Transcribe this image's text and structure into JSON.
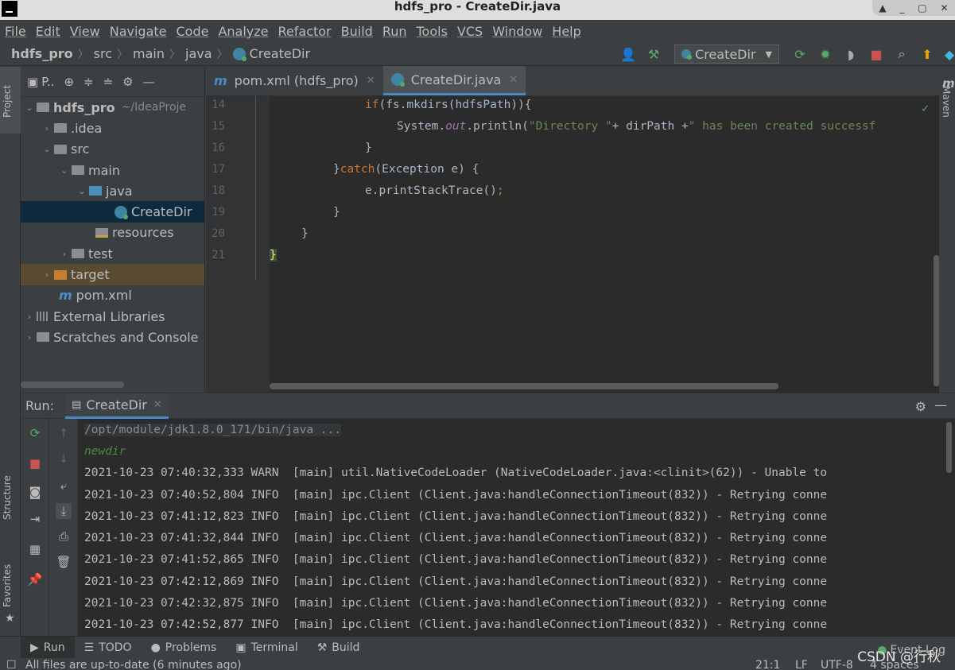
{
  "window": {
    "title": "hdfs_pro - CreateDir.java"
  },
  "menu": [
    "File",
    "Edit",
    "View",
    "Navigate",
    "Code",
    "Analyze",
    "Refactor",
    "Build",
    "Run",
    "Tools",
    "VCS",
    "Window",
    "Help"
  ],
  "breadcrumb": [
    "hdfs_pro",
    "src",
    "main",
    "java",
    "CreateDir"
  ],
  "toolbar": {
    "run_config": "CreateDir"
  },
  "side_tabs": {
    "project": "Project",
    "structure": "Structure",
    "favorites": "Favorites",
    "maven": "Maven"
  },
  "project": {
    "header": "P..",
    "tree": [
      {
        "label": "hdfs_pro",
        "extra": "~/IdeaProje"
      },
      {
        "label": ".idea"
      },
      {
        "label": "src"
      },
      {
        "label": "main"
      },
      {
        "label": "java"
      },
      {
        "label": "CreateDir"
      },
      {
        "label": "resources"
      },
      {
        "label": "test"
      },
      {
        "label": "target"
      },
      {
        "label": "pom.xml"
      },
      {
        "label": "External Libraries"
      },
      {
        "label": "Scratches and Console"
      }
    ]
  },
  "editor": {
    "tabs": [
      {
        "label": "pom.xml (hdfs_pro)"
      },
      {
        "label": "CreateDir.java"
      }
    ],
    "lines": [
      {
        "no": "14"
      },
      {
        "no": "15"
      },
      {
        "no": "16"
      },
      {
        "no": "17"
      },
      {
        "no": "18"
      },
      {
        "no": "19"
      },
      {
        "no": "20"
      },
      {
        "no": "21"
      }
    ],
    "code": {
      "l14_kw": "if",
      "l14_rest": "(fs.mkdirs(hdfsPath)){",
      "l15_a": "System.",
      "l15_field": "out",
      "l15_b": ".println(",
      "l15_str1": "\"Directory \"",
      "l15_c": "+ dirPath +",
      "l15_str2": "\" has been created successf",
      "l16": "}",
      "l17_a": "}",
      "l17_kw": "catch",
      "l17_rest": "(Exception e) {",
      "l18_a": "e.printStackTrace()",
      "l18_semi": ";",
      "l19": "}",
      "l20": "}",
      "l21": "}"
    }
  },
  "run": {
    "label": "Run:",
    "tab": "CreateDir",
    "lines": [
      "/opt/module/jdk1.8.0_171/bin/java ...",
      "newdir",
      "2021-10-23 07:40:32,333 WARN  [main] util.NativeCodeLoader (NativeCodeLoader.java:<clinit>(62)) - Unable to",
      "2021-10-23 07:40:52,804 INFO  [main] ipc.Client (Client.java:handleConnectionTimeout(832)) - Retrying conne",
      "2021-10-23 07:41:12,823 INFO  [main] ipc.Client (Client.java:handleConnectionTimeout(832)) - Retrying conne",
      "2021-10-23 07:41:32,844 INFO  [main] ipc.Client (Client.java:handleConnectionTimeout(832)) - Retrying conne",
      "2021-10-23 07:41:52,865 INFO  [main] ipc.Client (Client.java:handleConnectionTimeout(832)) - Retrying conne",
      "2021-10-23 07:42:12,869 INFO  [main] ipc.Client (Client.java:handleConnectionTimeout(832)) - Retrying conne",
      "2021-10-23 07:42:32,875 INFO  [main] ipc.Client (Client.java:handleConnectionTimeout(832)) - Retrying conne",
      "2021-10-23 07:42:52,877 INFO  [main] ipc.Client (Client.java:handleConnectionTimeout(832)) - Retrying conne"
    ]
  },
  "bottom_tabs": [
    "Run",
    "TODO",
    "Problems",
    "Terminal",
    "Build"
  ],
  "event_log": "Event Log",
  "status": {
    "message": "All files are up-to-date (6 minutes ago)",
    "position": "21:1",
    "line_sep": "LF",
    "encoding": "UTF-8",
    "indent": "4 spaces"
  },
  "watermark": "CSDN @行秋"
}
